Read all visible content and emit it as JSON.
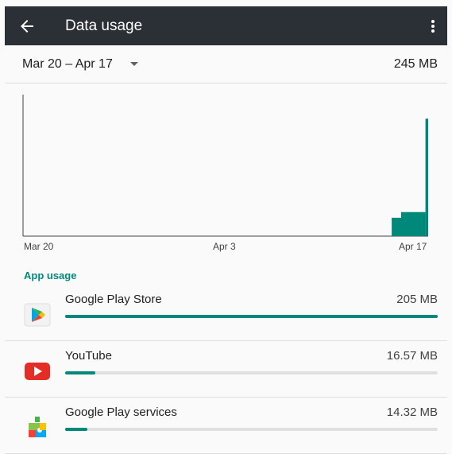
{
  "appbar": {
    "title": "Data usage",
    "back_icon": "arrow-back-icon",
    "menu_icon": "more-vert-icon"
  },
  "period": {
    "range": "Mar 20 – Apr 17",
    "total": "245 MB",
    "dropdown_icon": "chevron-down-icon"
  },
  "chart_data": {
    "type": "area",
    "x_labels": [
      "Mar 20",
      "Apr 3",
      "Apr 17"
    ],
    "description_series": "cumulative daily usage",
    "segments": [
      {
        "start_day": 0,
        "end_day": 27.3,
        "level": 0
      },
      {
        "start_day": 27.3,
        "end_day": 28.0,
        "level": 0.13
      },
      {
        "start_day": 28.0,
        "end_day": 29.8,
        "level": 0.17
      },
      {
        "start_day": 29.8,
        "end_day": 30.0,
        "level": 0.83
      }
    ],
    "color": "#00897b"
  },
  "app_usage": {
    "header": "App usage",
    "apps": [
      {
        "name": "Google Play Store",
        "size": "205 MB",
        "fraction": 1.0,
        "icon": "play-store-icon"
      },
      {
        "name": "YouTube",
        "size": "16.57 MB",
        "fraction": 0.08,
        "icon": "youtube-icon"
      },
      {
        "name": "Google Play services",
        "size": "14.32 MB",
        "fraction": 0.06,
        "icon": "play-services-icon"
      }
    ]
  }
}
